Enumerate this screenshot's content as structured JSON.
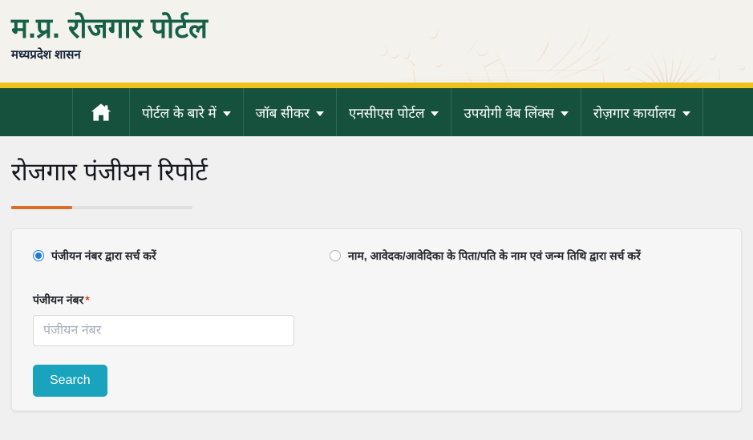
{
  "header": {
    "brand_title": "म.प्र. रोजगार पोर्टल",
    "brand_subtitle": "मध्यप्रदेश शासन",
    "decor_icon": "mandala-floral-pattern",
    "background_color": "#f4f2ec",
    "brand_color": "#166048"
  },
  "nav": {
    "gold_bar_color": "#eec219",
    "background_color": "#15513c",
    "home_icon": "home-icon",
    "items": [
      {
        "label": "पोर्टल के बारे में",
        "has_caret": true
      },
      {
        "label": "जॉब सीकर",
        "has_caret": true
      },
      {
        "label": "एनसीएस पोर्टल",
        "has_caret": true
      },
      {
        "label": "उपयोगी वेब लिंक्स",
        "has_caret": true
      },
      {
        "label": "रोज़गार कार्यालय",
        "has_caret": true
      }
    ]
  },
  "main": {
    "page_title": "रोजगार पंजीयन रिपोर्ट",
    "title_accent_color": "#dd6e28",
    "search_card": {
      "radio_options": [
        {
          "label": "पंजीयन नंबर द्वारा सर्च करें",
          "selected": true
        },
        {
          "label": "नाम, आवेदक/आवेदिका के पिता/पति के नाम एवं जन्म तिथि द्वारा सर्च करें",
          "selected": false
        }
      ],
      "field_label": "पंजीयन नंबर",
      "required_marker": "*",
      "input_value": "",
      "input_placeholder": "पंजीयन नंबर",
      "submit_label": "Search",
      "submit_color": "#19a3bd"
    }
  }
}
